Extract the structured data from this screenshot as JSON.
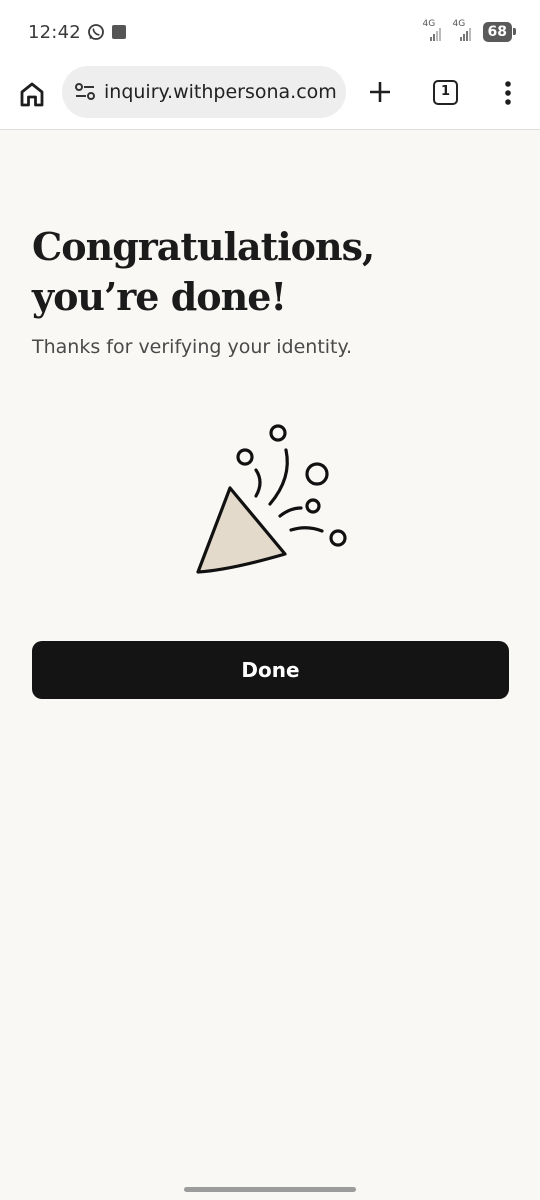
{
  "status_bar": {
    "time": "12:42",
    "notification_icons": [
      "whatsapp-icon",
      "square-notification-icon"
    ],
    "signal_1_label": "4G",
    "signal_2_label": "4G",
    "battery": "68"
  },
  "browser": {
    "url": "inquiry.withpersona.com",
    "tab_count": "1",
    "icons": [
      "home-icon",
      "site-settings-icon",
      "new-tab-icon",
      "tab-switcher-icon",
      "more-menu-icon"
    ]
  },
  "page": {
    "title": "Congratulations, you’re done!",
    "subtitle": "Thanks for verifying your identity.",
    "illustration": "party-popper-icon",
    "button_label": "Done"
  },
  "colors": {
    "page_background": "#f9f8f5",
    "button_background": "#141414",
    "button_text": "#ffffff",
    "popper_fill": "#e3dacb"
  }
}
